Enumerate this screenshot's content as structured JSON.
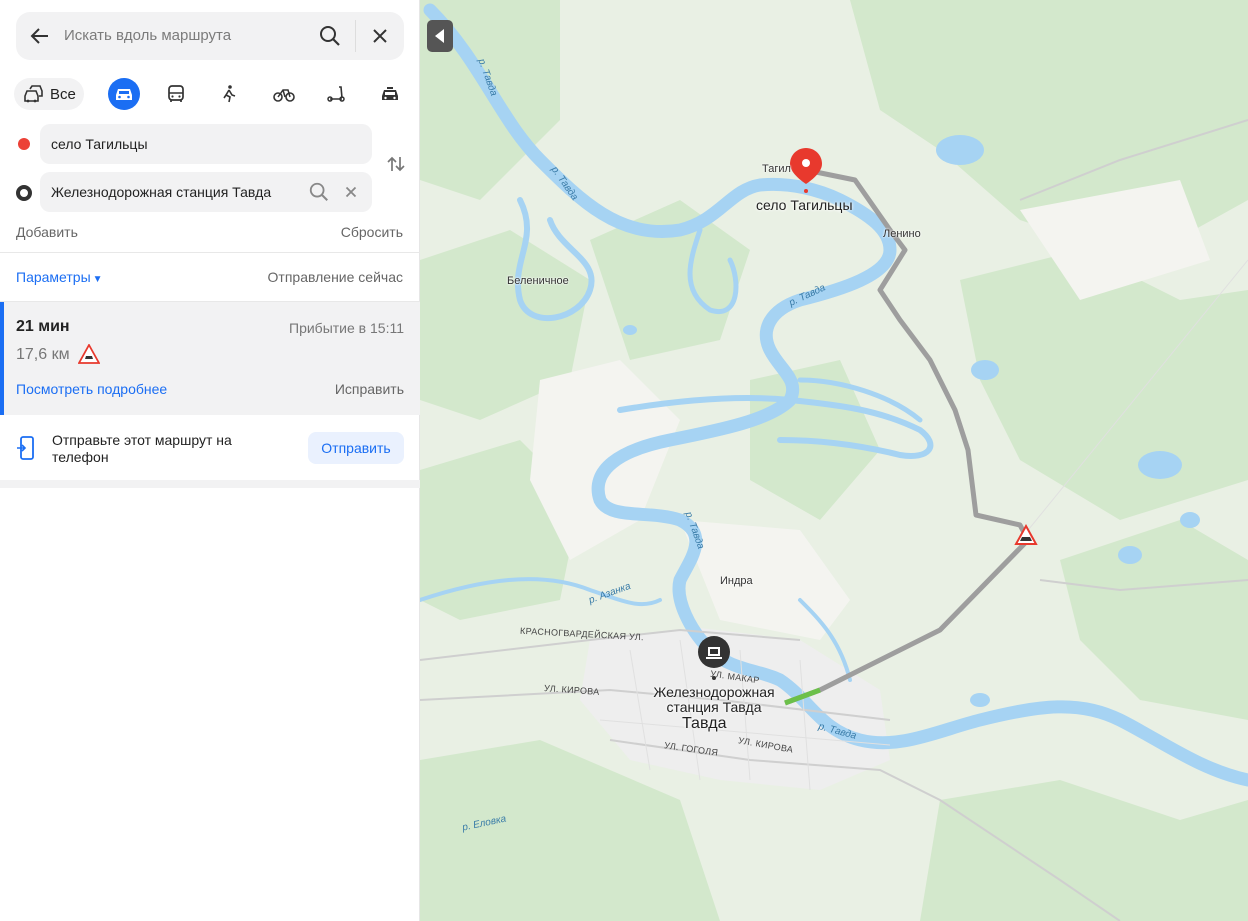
{
  "search": {
    "placeholder": "Искать вдоль маршрута"
  },
  "modes": {
    "all_label": "Все"
  },
  "route_form": {
    "from": "село Тагильцы",
    "to": "Железнодорожная станция Тавда",
    "add_label": "Добавить",
    "reset_label": "Сбросить"
  },
  "options": {
    "params_label": "Параметры",
    "departure": "Отправление сейчас"
  },
  "route": {
    "duration": "21 мин",
    "arrival": "Прибытие в 15:11",
    "distance": "17,6 км",
    "details_link": "Посмотреть подробнее",
    "fix_link": "Исправить"
  },
  "send": {
    "text": "Отправьте этот маршрут на телефон",
    "button": "Отправить"
  },
  "map": {
    "origin_label": "село Тагильцы",
    "origin_short": "Тагил",
    "dest_label_line1": "Железнодорожная",
    "dest_label_line2": "станция Тавда",
    "city": "Тавда",
    "places": {
      "lenino": "Ленино",
      "belenichnoe": "Беленичное",
      "indra": "Индра"
    },
    "rivers": {
      "tavda": "р. Тавда",
      "azanka": "р. Азанка",
      "elovka": "р. Еловка"
    },
    "streets": {
      "krasnogvardeyskaya": "КРАСНОГВАРДЕЙСКАЯ УЛ.",
      "kirova": "УЛ. КИРОВА",
      "gogolya": "УЛ. ГОГОЛЯ",
      "makar": "УЛ. МАКАР"
    },
    "colors": {
      "water": "#a8d4f2",
      "forest": "#cfe6c8",
      "town": "#f2f2f2",
      "route": "#9e9e9e",
      "route_active": "#6cc04a",
      "pin": "#e8392d"
    }
  }
}
